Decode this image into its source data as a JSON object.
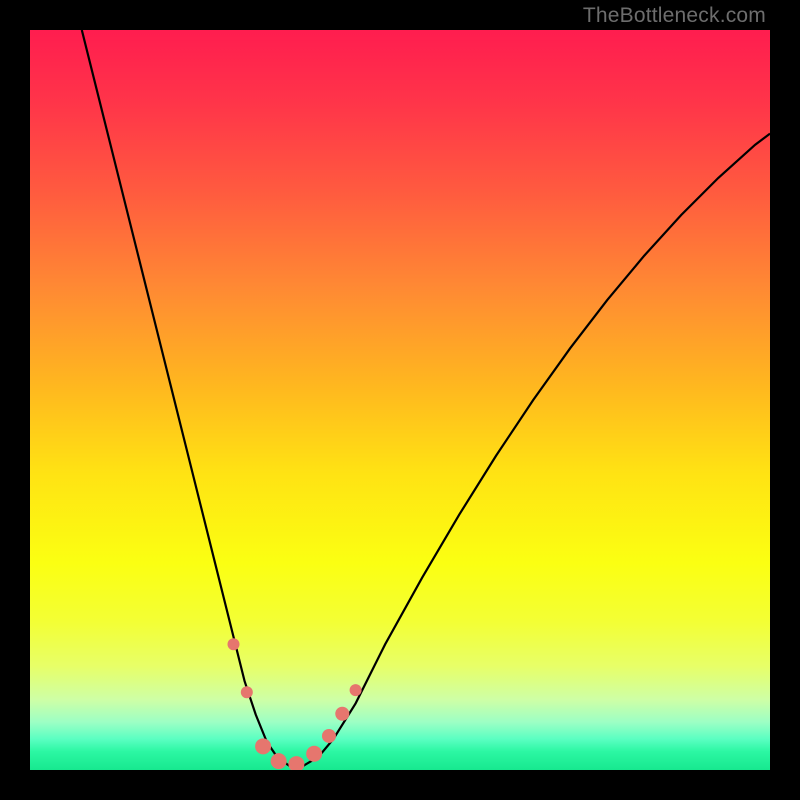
{
  "watermark": "TheBottleneck.com",
  "chart_data": {
    "type": "line",
    "title": "",
    "xlabel": "",
    "ylabel": "",
    "xlim": [
      0,
      100
    ],
    "ylim": [
      0,
      100
    ],
    "legend": false,
    "grid": false,
    "background": {
      "kind": "vertical-gradient",
      "stops": [
        {
          "pos": 0.0,
          "color": "#ff1d4f"
        },
        {
          "pos": 0.1,
          "color": "#ff3549"
        },
        {
          "pos": 0.22,
          "color": "#ff5b3f"
        },
        {
          "pos": 0.35,
          "color": "#ff8a33"
        },
        {
          "pos": 0.48,
          "color": "#ffb71f"
        },
        {
          "pos": 0.6,
          "color": "#ffe313"
        },
        {
          "pos": 0.72,
          "color": "#fbff12"
        },
        {
          "pos": 0.8,
          "color": "#f3ff35"
        },
        {
          "pos": 0.86,
          "color": "#e7ff68"
        },
        {
          "pos": 0.905,
          "color": "#ceffa6"
        },
        {
          "pos": 0.935,
          "color": "#9dffc4"
        },
        {
          "pos": 0.958,
          "color": "#5bffc2"
        },
        {
          "pos": 0.975,
          "color": "#2cf7a3"
        },
        {
          "pos": 1.0,
          "color": "#17e88f"
        }
      ]
    },
    "series": [
      {
        "name": "bottleneck-curve",
        "stroke": "#000000",
        "stroke_width": 2.2,
        "x": [
          7.0,
          9.0,
          11.0,
          13.0,
          15.0,
          17.0,
          19.0,
          21.0,
          23.0,
          25.0,
          27.0,
          29.0,
          30.5,
          32.0,
          33.5,
          35.0,
          37.0,
          39.0,
          41.0,
          44.0,
          48.0,
          53.0,
          58.0,
          63.0,
          68.0,
          73.0,
          78.0,
          83.0,
          88.0,
          93.0,
          98.0,
          100.0
        ],
        "y": [
          100.0,
          92.0,
          84.0,
          76.0,
          68.0,
          60.0,
          52.0,
          44.0,
          36.0,
          28.0,
          20.0,
          12.0,
          7.5,
          3.8,
          1.6,
          0.6,
          0.6,
          1.8,
          4.2,
          9.0,
          17.0,
          26.0,
          34.5,
          42.5,
          50.0,
          57.0,
          63.5,
          69.5,
          75.0,
          80.0,
          84.5,
          86.0
        ]
      }
    ],
    "markers": [
      {
        "x": 27.5,
        "y": 17.0,
        "r": 6,
        "color": "#e6766e"
      },
      {
        "x": 29.3,
        "y": 10.5,
        "r": 6,
        "color": "#e6766e"
      },
      {
        "x": 31.5,
        "y": 3.2,
        "r": 8,
        "color": "#e6766e"
      },
      {
        "x": 33.6,
        "y": 1.2,
        "r": 8,
        "color": "#e6766e"
      },
      {
        "x": 36.0,
        "y": 0.8,
        "r": 8,
        "color": "#e6766e"
      },
      {
        "x": 38.4,
        "y": 2.2,
        "r": 8,
        "color": "#e6766e"
      },
      {
        "x": 40.4,
        "y": 4.6,
        "r": 7,
        "color": "#e6766e"
      },
      {
        "x": 42.2,
        "y": 7.6,
        "r": 7,
        "color": "#e6766e"
      },
      {
        "x": 44.0,
        "y": 10.8,
        "r": 6,
        "color": "#e6766e"
      }
    ]
  }
}
